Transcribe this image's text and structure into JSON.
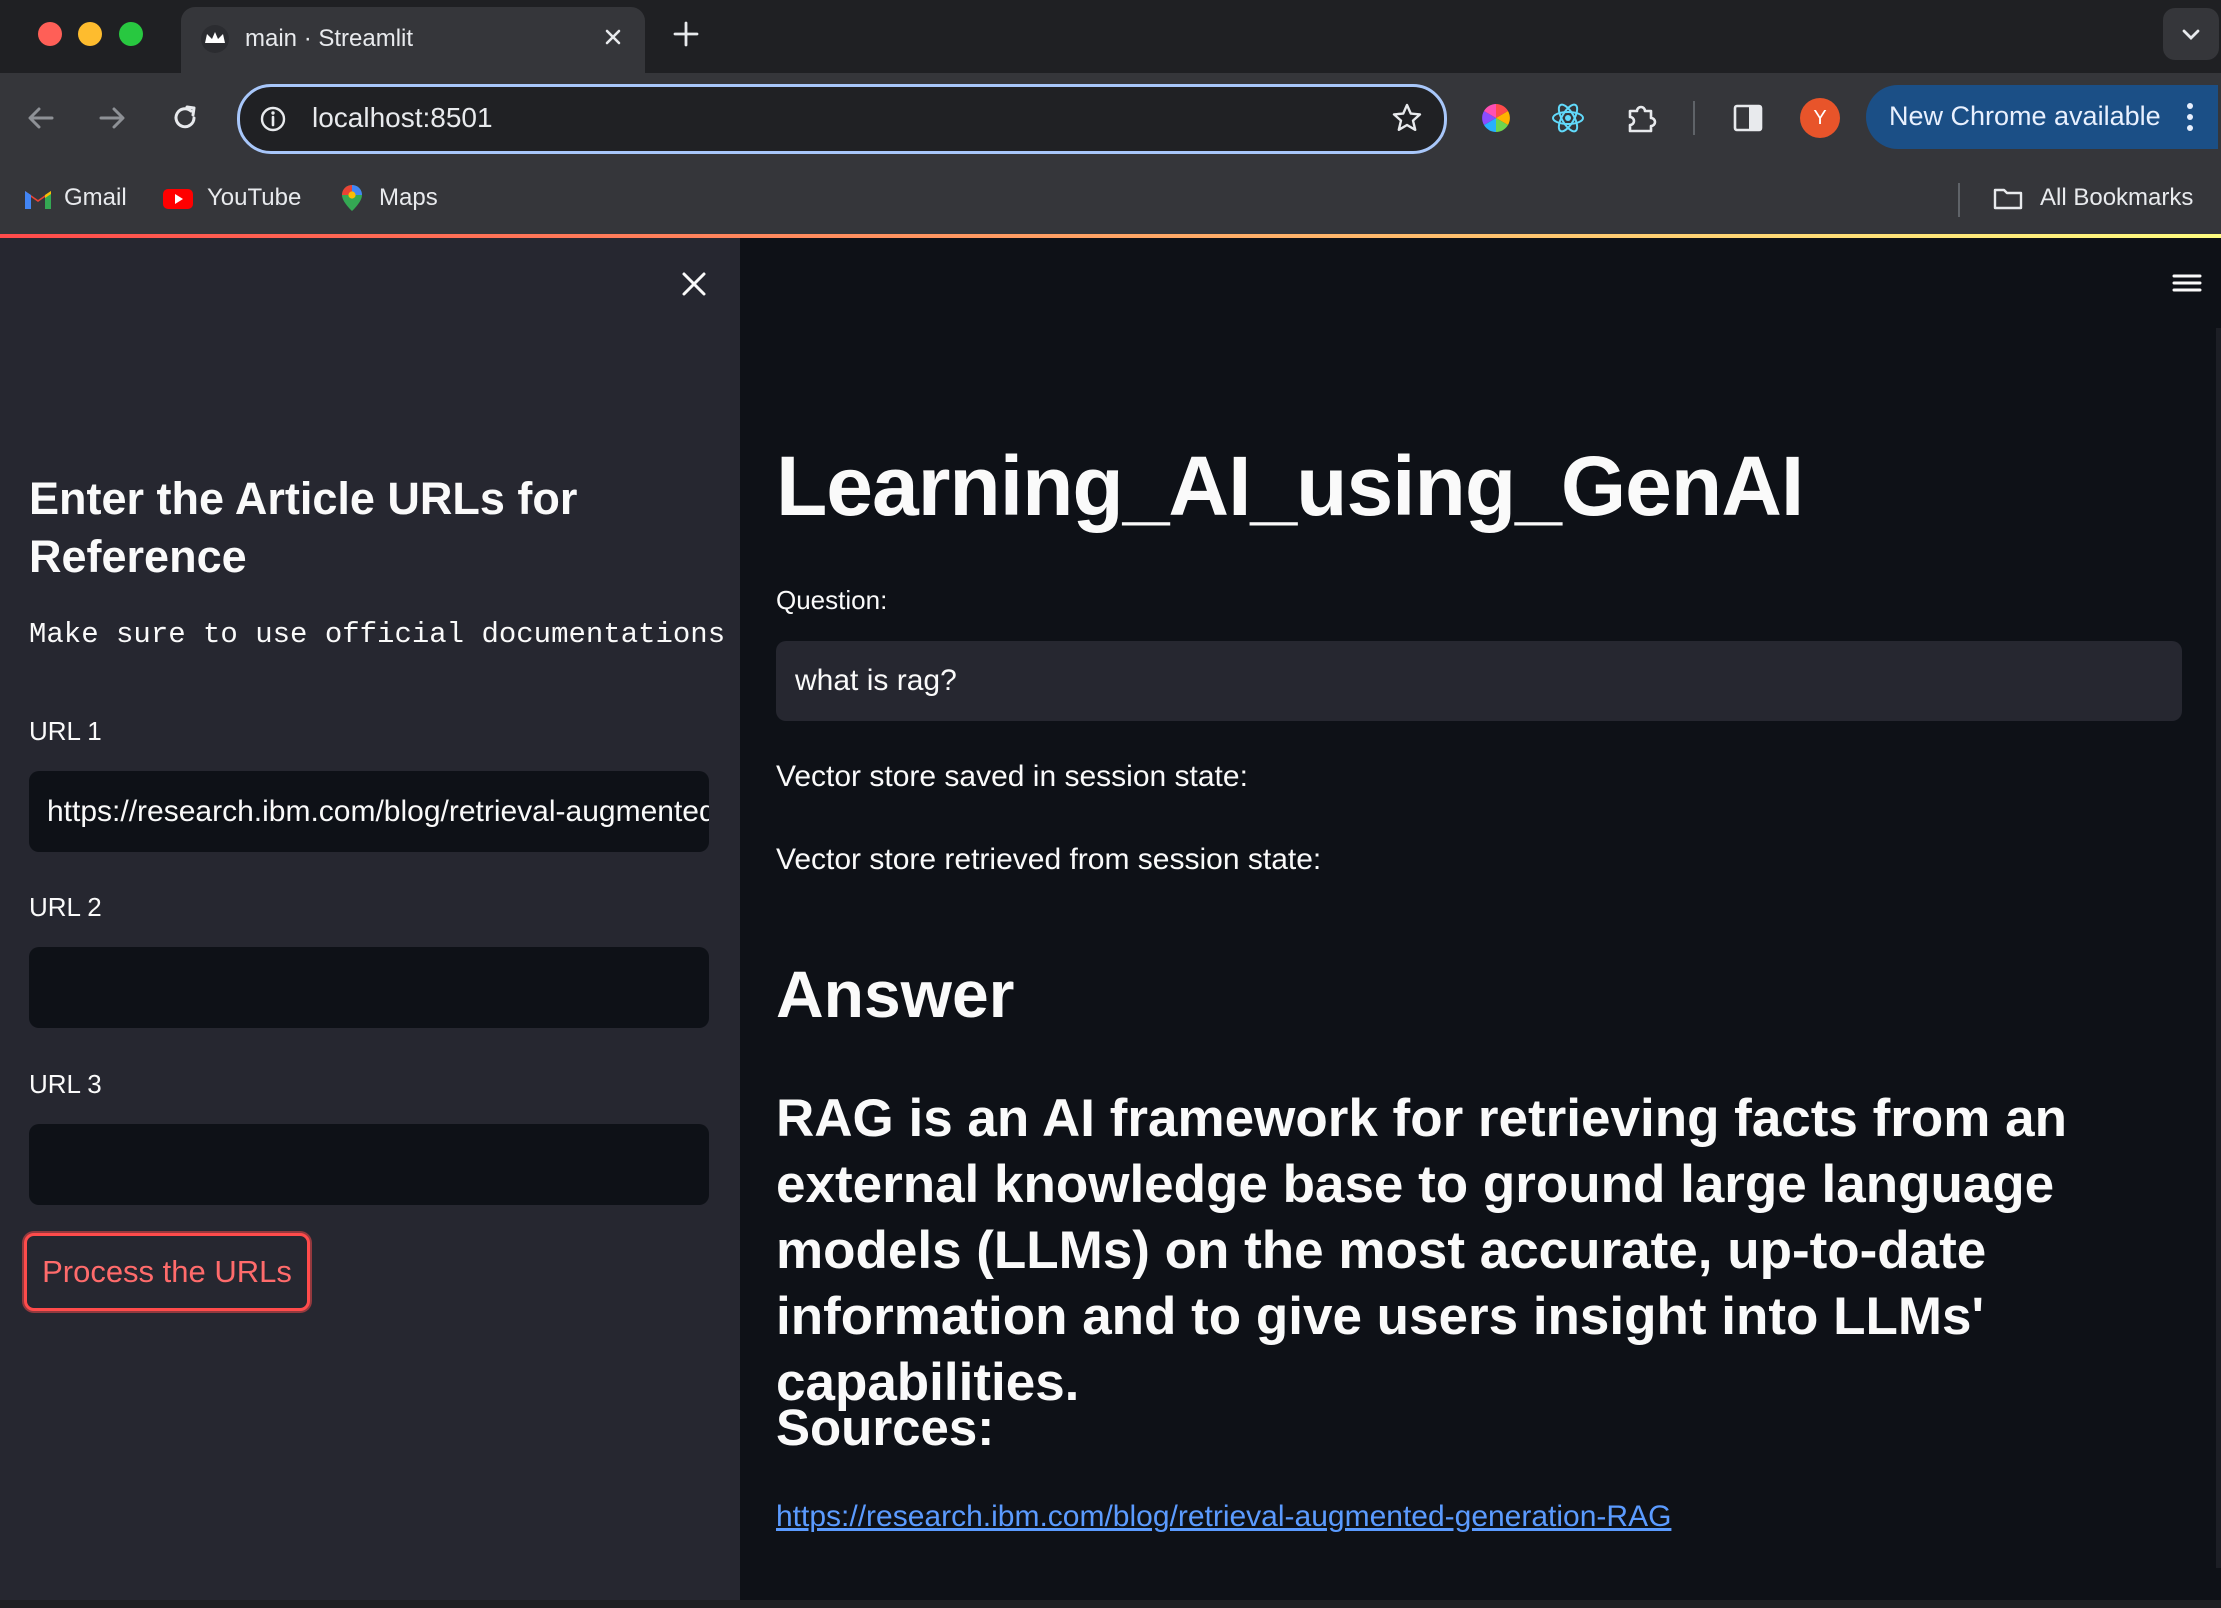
{
  "browser": {
    "tab_title": "main · Streamlit",
    "url": "localhost:8501",
    "update_label": "New Chrome available",
    "profile_initial": "Y",
    "bookmarks": [
      {
        "label": "Gmail",
        "icon": "gmail-icon"
      },
      {
        "label": "YouTube",
        "icon": "youtube-icon"
      },
      {
        "label": "Maps",
        "icon": "maps-icon"
      }
    ],
    "all_bookmarks_label": "All Bookmarks",
    "colors": {
      "omnibox_focus": "#a8c7fa",
      "update_pill": "#1b4f86"
    }
  },
  "sidebar": {
    "heading": "Enter the Article URLs for Reference",
    "note": "Make sure to use official documentations",
    "urls": [
      {
        "label": "URL 1",
        "value": "https://research.ibm.com/blog/retrieval-augmented-generation-RAG"
      },
      {
        "label": "URL 2",
        "value": ""
      },
      {
        "label": "URL 3",
        "value": ""
      }
    ],
    "process_button": "Process the URLs"
  },
  "main": {
    "title": "Learning_AI_using_GenAI",
    "question_label": "Question:",
    "question_value": "what is rag?",
    "status_saved": "Vector store saved in session state:",
    "status_retrieved": "Vector store retrieved from session state:",
    "answer_heading": "Answer",
    "answer_text": "RAG is an AI framework for retrieving facts from an external knowledge base to ground large language models (LLMs) on the most accurate, up-to-date information and to give users insight into LLMs' capabilities.",
    "sources_heading": "Sources:",
    "source_link": "https://research.ibm.com/blog/retrieval-augmented-generation-RAG"
  },
  "theme": {
    "background": "#0e1117",
    "sidebar": "#262730",
    "primary": "#ff4b4b",
    "link": "#5b9bff"
  }
}
